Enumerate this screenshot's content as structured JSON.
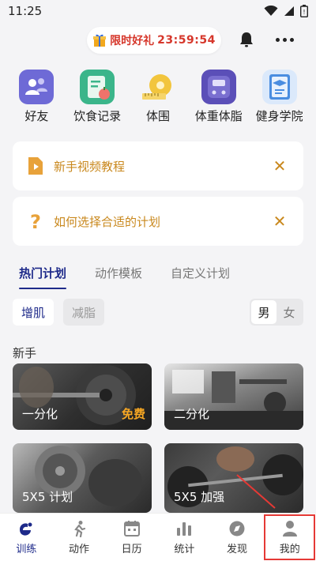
{
  "status_bar": {
    "time": "11:25"
  },
  "promo": {
    "label": "限时好礼",
    "timer": "23:59:54"
  },
  "shortcuts": [
    {
      "label": "好友",
      "icon": "friends-icon",
      "color": "#6e6ad6"
    },
    {
      "label": "饮食记录",
      "icon": "diet-record-icon",
      "color": "#3bb58a"
    },
    {
      "label": "体围",
      "icon": "tape-measure-icon",
      "color": "#f2c53d"
    },
    {
      "label": "体重体脂",
      "icon": "scale-icon",
      "color": "#5b4fb8"
    },
    {
      "label": "健身学院",
      "icon": "academy-icon",
      "color": "#4a8de0"
    }
  ],
  "notices": [
    {
      "text": "新手视频教程",
      "close": "✕"
    },
    {
      "text": "如何选择合适的计划",
      "close": "✕"
    }
  ],
  "plan_tabs": [
    "热门计划",
    "动作模板",
    "自定义计划"
  ],
  "goals": {
    "active": "增肌",
    "inactive": "减脂"
  },
  "gender": {
    "male": "男",
    "female": "女"
  },
  "section": {
    "title": "新手"
  },
  "cards": [
    {
      "title": "一分化",
      "badge": "免费"
    },
    {
      "title": "二分化"
    },
    {
      "title": "5X5 计划"
    },
    {
      "title": "5X5 加强"
    }
  ],
  "bottom_nav": [
    {
      "label": "训练",
      "icon": "training-icon"
    },
    {
      "label": "动作",
      "icon": "exercise-icon"
    },
    {
      "label": "日历",
      "icon": "calendar-icon"
    },
    {
      "label": "统计",
      "icon": "stats-icon"
    },
    {
      "label": "发现",
      "icon": "discover-icon"
    },
    {
      "label": "我的",
      "icon": "profile-icon"
    }
  ],
  "colors": {
    "accent": "#1e2a8a",
    "notice_text": "#c9881d",
    "promo_text": "#d6372b",
    "free_badge": "#f5a623",
    "highlight": "#e53935"
  }
}
